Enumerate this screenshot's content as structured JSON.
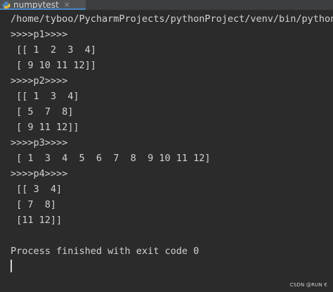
{
  "tab": {
    "title": "numpytest",
    "close_glyph": "×",
    "icon": "python-icon"
  },
  "console": {
    "command": "/home/tyboo/PycharmProjects/pythonProject/venv/bin/python /hc",
    "lines": [
      ">>>>p1>>>>",
      " [[ 1  2  3  4]",
      " [ 9 10 11 12]]",
      ">>>>p2>>>>",
      " [[ 1  3  4]",
      " [ 5  7  8]",
      " [ 9 11 12]]",
      ">>>>p3>>>>",
      " [ 1  3  4  5  6  7  8  9 10 11 12]",
      ">>>>p4>>>>",
      " [[ 3  4]",
      " [ 7  8]",
      " [11 12]]",
      "",
      "Process finished with exit code 0"
    ]
  },
  "watermark": "CSDN @RUN €"
}
